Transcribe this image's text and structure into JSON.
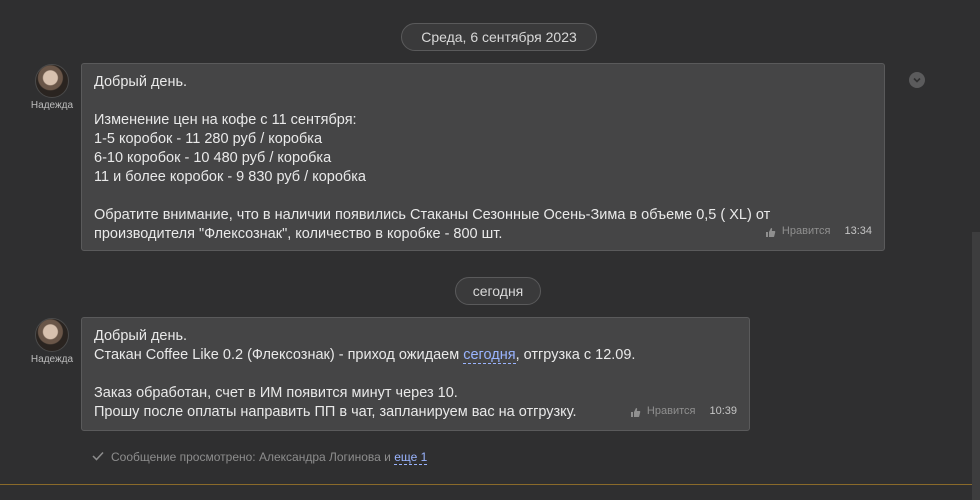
{
  "dividers": {
    "date1": "Среда, 6 сентября 2023",
    "date2": "сегодня"
  },
  "messages": [
    {
      "author": "Надежда",
      "lines": [
        "Добрый день.",
        "",
        "Изменение цен на кофе с 11 сентября:",
        "1-5 коробок - 11 280 руб / коробка",
        "6-10 коробок - 10 480 руб / коробка",
        "11 и более коробок - 9 830 руб / коробка",
        "",
        "Обратите внимание, что в наличии появились Стаканы Сезонные Осень-Зима в объеме 0,5 ( XL) от",
        "производителя \"Флексознак\", количество в коробке - 800 шт."
      ],
      "like_label": "Нравится",
      "time": "13:34"
    },
    {
      "author": "Надежда",
      "line1": "Добрый день.",
      "line2_before": "Стакан Coffee Like 0.2 (Флексознак) - приход ожидаем ",
      "line2_link": "сегодня",
      "line2_after": ", отгрузка с 12.09.",
      "line3": "Заказ обработан, счет в ИМ появится минут через 10.",
      "line4": "Прошу после оплаты направить ПП в чат, запланируем вас на отгрузку.",
      "like_label": "Нравится",
      "time": "10:39"
    }
  ],
  "seen": {
    "text": "Сообщение просмотрено: Александра Логинова и ",
    "more": "еще 1"
  },
  "colors": {
    "accent_link": "#9ab4ff",
    "bottom_line": "#8a6a2a"
  }
}
